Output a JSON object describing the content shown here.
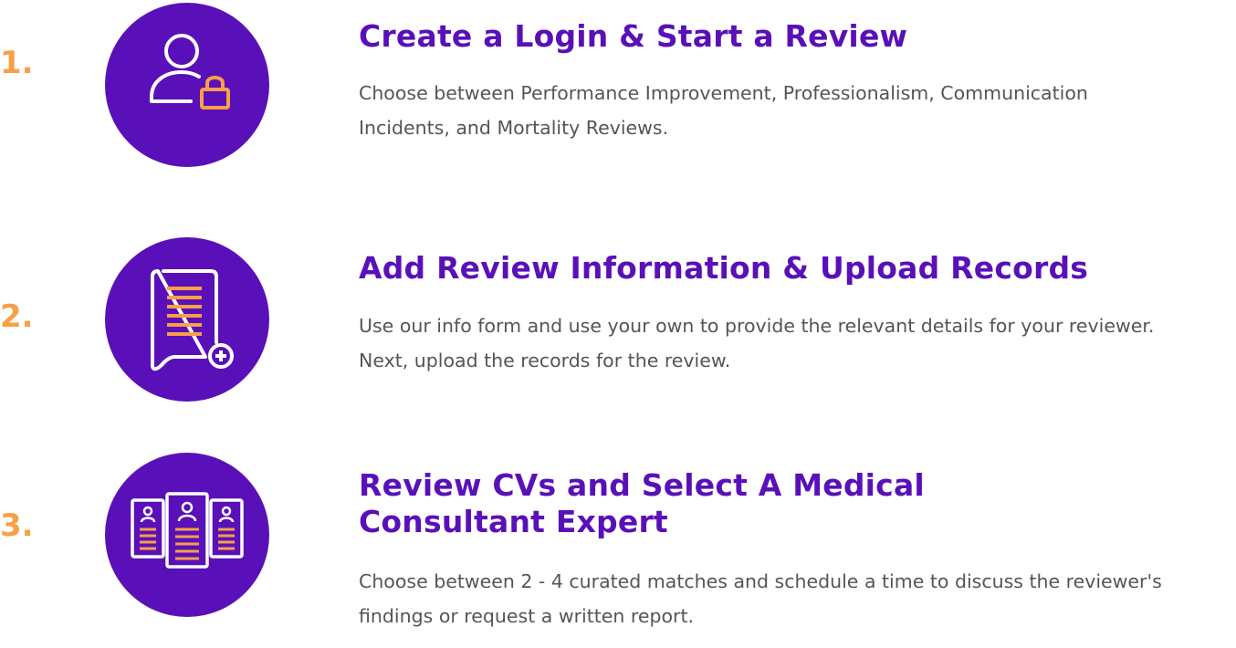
{
  "colors": {
    "accent_purple": "#5a10b8",
    "accent_orange": "#f7a048",
    "text_gray": "#555555"
  },
  "steps": [
    {
      "number": "1.",
      "icon": "user-lock-icon",
      "title": "Create a Login & Start a Review",
      "description": "Choose between Performance Improvement, Professionalism, Communication Incidents, and Mortality Reviews."
    },
    {
      "number": "2.",
      "icon": "document-add-icon",
      "title": "Add Review Information & Upload Records",
      "description": "Use our info form and use your own to provide the relevant details for your reviewer. Next, upload the records for the review."
    },
    {
      "number": "3.",
      "icon": "cv-profiles-icon",
      "title": "Review CVs and Select A Medical Consultant Expert",
      "description": "Choose between 2 - 4 curated matches and schedule a time to discuss the reviewer's findings or request a written report."
    }
  ]
}
